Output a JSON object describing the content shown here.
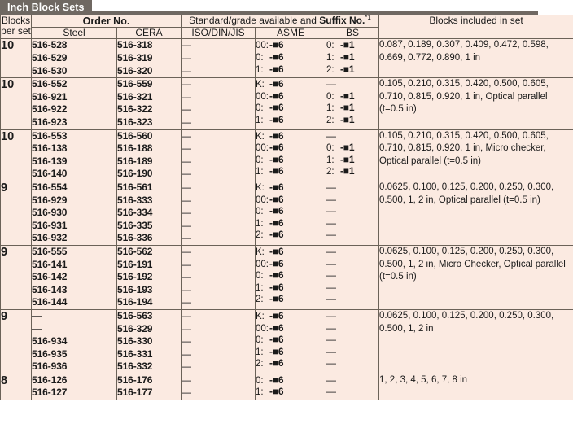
{
  "title": "Inch Block Sets",
  "header": {
    "blocks_per_set_l1": "Blocks",
    "blocks_per_set_l2": "per set",
    "order_no": "Order No.",
    "steel": "Steel",
    "cera": "CERA",
    "standard_grade_pre": "Standard/grade available and ",
    "standard_grade_bold": "Suffix No.",
    "standard_grade_sup": "*1",
    "iso_din_jis": "ISO/DIN/JIS",
    "asme": "ASME",
    "bs": "BS",
    "blocks_included": "Blocks included in set"
  },
  "colors": {
    "title_bar": "#6f6862",
    "header_fill": "#efc6ae",
    "body_fill": "#fbeae1",
    "border": "#6b6258",
    "text": "#1a1a1a"
  },
  "rows": [
    {
      "count": "10",
      "steel": [
        "516-528",
        "516-529",
        "516-530"
      ],
      "cera": [
        "516-318",
        "516-319",
        "516-320"
      ],
      "iso": [
        "—",
        "—",
        "—"
      ],
      "asme": [
        {
          "key": "00:",
          "val": "-■6"
        },
        {
          "key": "0:",
          "val": "-■6"
        },
        {
          "key": "1:",
          "val": "-■6"
        }
      ],
      "bs": [
        {
          "key": "0:",
          "val": "-■1"
        },
        {
          "key": "1:",
          "val": "-■1"
        },
        {
          "key": "2:",
          "val": "-■1"
        }
      ],
      "blocks": "0.087, 0.189, 0.307, 0.409, 0.472, 0.598, 0.669, 0.772, 0.890, 1 in"
    },
    {
      "count": "10",
      "steel": [
        "516-552",
        "516-921",
        "516-922",
        "516-923"
      ],
      "cera": [
        "516-559",
        "516-321",
        "516-322",
        "516-323"
      ],
      "iso": [
        "—",
        "—",
        "—",
        "—"
      ],
      "asme": [
        {
          "key": "K:",
          "val": "-■6"
        },
        {
          "key": "00:",
          "val": "-■6"
        },
        {
          "key": "0:",
          "val": "-■6"
        },
        {
          "key": "1:",
          "val": "-■6"
        }
      ],
      "bs": [
        {
          "key": "",
          "val": "",
          "dash": "—"
        },
        {
          "key": "0:",
          "val": "-■1"
        },
        {
          "key": "1:",
          "val": "-■1"
        },
        {
          "key": "2:",
          "val": "-■1"
        }
      ],
      "blocks": "0.105, 0.210, 0.315, 0.420, 0.500, 0.605, 0.710, 0.815, 0.920, 1 in, Optical parallel (t=0.5 in)"
    },
    {
      "count": "10",
      "steel": [
        "516-553",
        "516-138",
        "516-139",
        "516-140"
      ],
      "cera": [
        "516-560",
        "516-188",
        "516-189",
        "516-190"
      ],
      "iso": [
        "—",
        "—",
        "—",
        "—"
      ],
      "asme": [
        {
          "key": "K:",
          "val": "-■6"
        },
        {
          "key": "00:",
          "val": "-■6"
        },
        {
          "key": "0:",
          "val": "-■6"
        },
        {
          "key": "1:",
          "val": "-■6"
        }
      ],
      "bs": [
        {
          "key": "",
          "val": "",
          "dash": "—"
        },
        {
          "key": "0:",
          "val": "-■1"
        },
        {
          "key": "1:",
          "val": "-■1"
        },
        {
          "key": "2:",
          "val": "-■1"
        }
      ],
      "blocks": "0.105, 0.210, 0.315, 0.420, 0.500, 0.605, 0.710, 0.815, 0.920, 1 in, Micro checker, Optical parallel (t=0.5 in)"
    },
    {
      "count": "9",
      "steel": [
        "516-554",
        "516-929",
        "516-930",
        "516-931",
        "516-932"
      ],
      "cera": [
        "516-561",
        "516-333",
        "516-334",
        "516-335",
        "516-336"
      ],
      "iso": [
        "—",
        "—",
        "—",
        "—",
        "—"
      ],
      "asme": [
        {
          "key": "K:",
          "val": "-■6"
        },
        {
          "key": "00:",
          "val": "-■6"
        },
        {
          "key": "0:",
          "val": "-■6"
        },
        {
          "key": "1:",
          "val": "-■6"
        },
        {
          "key": "2:",
          "val": "-■6"
        }
      ],
      "bs": [
        {
          "key": "",
          "val": "",
          "dash": "—"
        },
        {
          "key": "",
          "val": "",
          "dash": "—"
        },
        {
          "key": "",
          "val": "",
          "dash": "—"
        },
        {
          "key": "",
          "val": "",
          "dash": "—"
        },
        {
          "key": "",
          "val": "",
          "dash": "—"
        }
      ],
      "blocks": "0.0625, 0.100, 0.125, 0.200, 0.250, 0.300, 0.500, 1, 2 in, Optical parallel (t=0.5 in)"
    },
    {
      "count": "9",
      "steel": [
        "516-555",
        "516-141",
        "516-142",
        "516-143",
        "516-144"
      ],
      "cera": [
        "516-562",
        "516-191",
        "516-192",
        "516-193",
        "516-194"
      ],
      "iso": [
        "—",
        "—",
        "—",
        "—",
        "—"
      ],
      "asme": [
        {
          "key": "K:",
          "val": "-■6"
        },
        {
          "key": "00:",
          "val": "-■6"
        },
        {
          "key": "0:",
          "val": "-■6"
        },
        {
          "key": "1:",
          "val": "-■6"
        },
        {
          "key": "2:",
          "val": "-■6"
        }
      ],
      "bs": [
        {
          "key": "",
          "val": "",
          "dash": "—"
        },
        {
          "key": "",
          "val": "",
          "dash": "—"
        },
        {
          "key": "",
          "val": "",
          "dash": "—"
        },
        {
          "key": "",
          "val": "",
          "dash": "—"
        },
        {
          "key": "",
          "val": "",
          "dash": "—"
        }
      ],
      "blocks": "0.0625, 0.100, 0.125, 0.200, 0.250, 0.300, 0.500, 1, 2 in, Micro Checker, Optical parallel (t=0.5 in)"
    },
    {
      "count": "9",
      "steel": [
        "—",
        "—",
        "516-934",
        "516-935",
        "516-936"
      ],
      "cera": [
        "516-563",
        "516-329",
        "516-330",
        "516-331",
        "516-332"
      ],
      "iso": [
        "—",
        "—",
        "—",
        "—",
        "—"
      ],
      "asme": [
        {
          "key": "K:",
          "val": "-■6"
        },
        {
          "key": "00:",
          "val": "-■6"
        },
        {
          "key": "0:",
          "val": "-■6"
        },
        {
          "key": "1:",
          "val": "-■6"
        },
        {
          "key": "2:",
          "val": "-■6"
        }
      ],
      "bs": [
        {
          "key": "",
          "val": "",
          "dash": "—"
        },
        {
          "key": "",
          "val": "",
          "dash": "—"
        },
        {
          "key": "",
          "val": "",
          "dash": "—"
        },
        {
          "key": "",
          "val": "",
          "dash": "—"
        },
        {
          "key": "",
          "val": "",
          "dash": "—"
        }
      ],
      "blocks": "0.0625, 0.100, 0.125, 0.200, 0.250, 0.300, 0.500, 1, 2 in"
    },
    {
      "count": "8",
      "steel": [
        "516-126",
        "516-127"
      ],
      "cera": [
        "516-176",
        "516-177"
      ],
      "iso": [
        "—",
        "—"
      ],
      "asme": [
        {
          "key": "0:",
          "val": "-■6"
        },
        {
          "key": "1:",
          "val": "-■6"
        }
      ],
      "bs": [
        {
          "key": "",
          "val": "",
          "dash": "—"
        },
        {
          "key": "",
          "val": "",
          "dash": "—"
        }
      ],
      "blocks": "1, 2, 3, 4, 5, 6, 7, 8 in"
    }
  ]
}
